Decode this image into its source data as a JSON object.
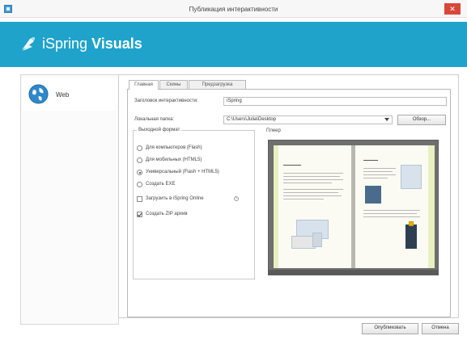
{
  "window": {
    "title": "Публикация интерактивности",
    "close_glyph": "✕"
  },
  "brand": {
    "prefix": "iSpring",
    "suffix": "Visuals"
  },
  "sidebar": {
    "items": [
      {
        "label": "Web",
        "icon": "globe-icon"
      }
    ]
  },
  "tabs": [
    {
      "label": "Главная",
      "active": true
    },
    {
      "label": "Скины",
      "active": false
    },
    {
      "label": "Предзагрузка",
      "active": false
    }
  ],
  "form": {
    "title_label": "Заголовок интерактивности:",
    "title_value": "iSpring",
    "folder_label": "Локальная папка:",
    "folder_value": "C:\\Users\\Julia\\Desktop",
    "browse_label": "Обзор..."
  },
  "output_group": {
    "title": "Выходной формат",
    "options": [
      {
        "label": "Для компьютеров (Flash)",
        "type": "radio",
        "checked": false
      },
      {
        "label": "Для мобильных (HTML5)",
        "type": "radio",
        "checked": false
      },
      {
        "label": "Универсальный (Flash + HTML5)",
        "type": "radio",
        "checked": true
      },
      {
        "label": "Создать EXE",
        "type": "radio",
        "checked": false
      },
      {
        "label": "Загрузить в iSpring Online",
        "type": "checkbox",
        "checked": false
      },
      {
        "label": "Создать ZIP архив",
        "type": "checkbox",
        "checked": true
      }
    ]
  },
  "preview": {
    "title": "Плеер"
  },
  "actions": {
    "publish": "Опубликовать",
    "cancel": "Отмена"
  },
  "colors": {
    "banner": "#1fa3cb",
    "close": "#d9473b"
  }
}
